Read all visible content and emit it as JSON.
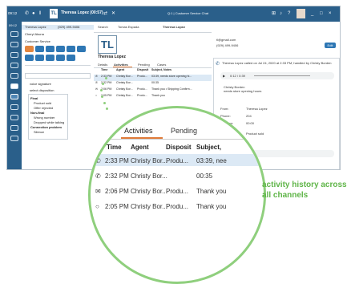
{
  "topbar": {
    "time": "09:12",
    "agent_name": "Theresa Lopez (00:57)",
    "logo": "TL",
    "center_text": "Q:1 | Customer Service Chat",
    "window_controls": [
      "?",
      "_",
      "□",
      "×"
    ]
  },
  "leftpanel": {
    "conversations": [
      {
        "name": "Theresa Lopez",
        "phone": "(929) 499-9406"
      },
      {
        "name": "Cheryl Akuna"
      }
    ],
    "queue": "Customer Service",
    "label_a": "voice signature",
    "label_b": "select disposition",
    "dispositions": {
      "groups": [
        {
          "title": "Final",
          "items": [
            "Product sold",
            "Offer rejected"
          ]
        },
        {
          "title": "Non-final",
          "items": [
            "Wrong number",
            "Dropped while talking"
          ]
        },
        {
          "title": "Connection problem",
          "items": [
            "Silence"
          ]
        }
      ]
    }
  },
  "midpanel": {
    "tabs": [
      "Search",
      "Tomas Espada",
      "Theresa Lopez"
    ],
    "logo": "TL",
    "contact_name": "Theresa Lopez",
    "subtabs": [
      "Details",
      "Activities",
      "Pending",
      "Cases"
    ],
    "activity_headers": [
      "Time",
      "Agent",
      "Disposit",
      "Subject, Notes"
    ],
    "activities": [
      {
        "time": "2:33 PM",
        "agent": "Christy Bor...",
        "disposition": "Produ...",
        "subject": "03:39, needs store opening hi..."
      },
      {
        "time": "2:32 PM",
        "agent": "Christy Bor...",
        "disposition": "",
        "subject": "00:35"
      },
      {
        "time": "2:06 PM",
        "agent": "Christy Bor...",
        "disposition": "Produ...",
        "subject": "Thank you • Shipping Confirm..."
      },
      {
        "time": "2:05 PM",
        "agent": "Christy Bor...",
        "disposition": "Produ...",
        "subject": "Thank you"
      }
    ]
  },
  "rightpanel": {
    "email": "tl@gmail.com",
    "phone": "(929) 499-9406",
    "call_title": "Theresa Lopez called on Jul 24, 2020 at 2:33 PM, handled by Christy Borden",
    "player_time": "0:12 / 0:39",
    "note_author": "Christy Borden",
    "note_text": "needs store opening hours",
    "from_label": "From:",
    "from_value": "Theresa Lopez",
    "phone_label": "Phone:",
    "phone_value": "204",
    "duration_label": "Duration:",
    "duration_value": "00:00",
    "disposition_label": "Disposition:",
    "disposition_value": "Product sold",
    "name_label": "Name checked:",
    "address_label": "Address checked:",
    "details_label": "Details",
    "edit_label": "Edit"
  },
  "zoom": {
    "tabs": [
      "Details",
      "Activities",
      "Pending"
    ],
    "headers": [
      "Time",
      "Agent",
      "Disposit",
      "Subject,"
    ],
    "rows": [
      {
        "time": "2:33 PM",
        "agent": "Christy Bor...",
        "disposition": "Produ...",
        "subject": "03:39, nee"
      },
      {
        "time": "2:32 PM",
        "agent": "Christy Bor...",
        "disposition": "",
        "subject": "00:35"
      },
      {
        "time": "2:06 PM",
        "agent": "Christy Bor...",
        "disposition": "Produ...",
        "subject": "Thank you"
      },
      {
        "time": "2:05 PM",
        "agent": "Christy Bor...",
        "disposition": "Produ...",
        "subject": "Thank you"
      }
    ]
  },
  "caption": "activity history across all channels",
  "colors": {
    "topbar": "#2a5f8a",
    "accent": "#2e77b4",
    "green": "#8fcf7d",
    "caption": "#5fb548",
    "highlight": "#dce9f5",
    "tab_underline": "#e07b39"
  }
}
